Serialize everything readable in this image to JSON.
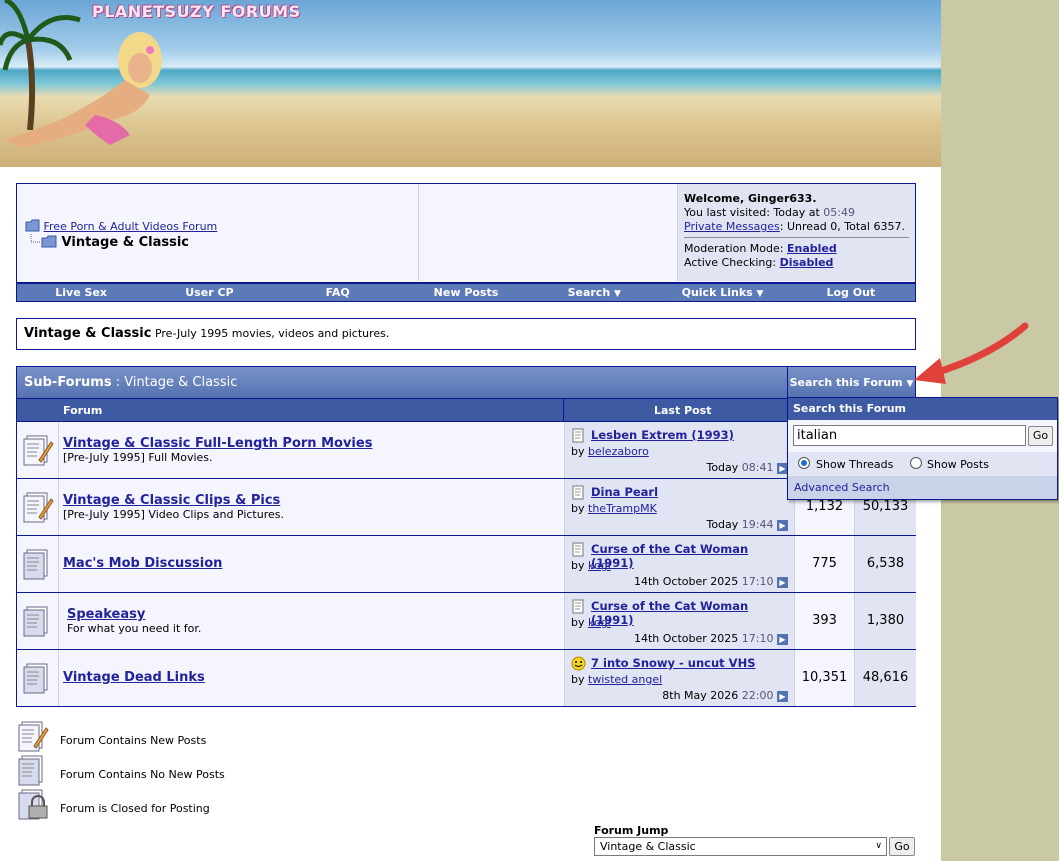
{
  "banner": {
    "logo_text": "PLANETSUZY FORUMS"
  },
  "breadcrumb": {
    "parent_link": "Free Porn & Adult Videos Forum",
    "current": "Vintage & Classic"
  },
  "user_panel": {
    "welcome": "Welcome, Ginger633.",
    "last_visited_label": "You last visited: Today at",
    "last_visited_time": "05:49",
    "pm_link": "Private Messages",
    "pm_text": ": Unread 0, Total 6357.",
    "moderation_label": "Moderation Mode:",
    "moderation_value": "Enabled",
    "checking_label": "Active Checking:",
    "checking_value": "Disabled"
  },
  "navbar": [
    "Live Sex",
    "User CP",
    "FAQ",
    "New Posts",
    "Search",
    "Quick Links",
    "Log Out"
  ],
  "forum_desc": {
    "name": "Vintage & Classic",
    "text": "Pre-July 1995 movies, videos and pictures."
  },
  "subforums": {
    "header_label": "Sub-Forums",
    "header_sep": " : ",
    "header_name": "Vintage & Classic",
    "search_button": "Search this Forum",
    "col_forum": "Forum",
    "col_last_post": "Last Post",
    "rows": [
      {
        "title": "Vintage & Classic Full-Length Porn Movies",
        "desc": "[Pre-July 1995] Full Movies.",
        "lp_title": "Lesben Extrem (1993)",
        "lp_by": "by",
        "lp_user": "belezaboro",
        "lp_date": "Today",
        "lp_time": "08:41",
        "threads": "",
        "posts": ""
      },
      {
        "title": "Vintage & Classic Clips & Pics",
        "desc": "[Pre-July 1995] Video Clips and Pictures.",
        "lp_title": "Dina Pearl",
        "lp_by": "by",
        "lp_user": "theTrampMK",
        "lp_date": "Today",
        "lp_time": "19:44",
        "threads": "1,132",
        "posts": "50,133"
      },
      {
        "title": "Mac's Mob Discussion",
        "desc": "",
        "lp_title": "Curse of the Cat Woman (1991)",
        "lp_by": "by",
        "lp_user": "kogi",
        "lp_date": "14th October 2025",
        "lp_time": "17:10",
        "threads": "775",
        "posts": "6,538"
      },
      {
        "title": "Speakeasy",
        "desc": "For what you need it for.",
        "lp_title": "Curse of the Cat Woman (1991)",
        "lp_by": "by",
        "lp_user": "kogi",
        "lp_date": "14th October 2025",
        "lp_time": "17:10",
        "threads": "393",
        "posts": "1,380"
      },
      {
        "title": "Vintage Dead Links",
        "desc": "",
        "lp_title": "7 into Snowy - uncut VHS",
        "lp_by": "by",
        "lp_user": "twisted angel",
        "lp_date": "8th May 2026",
        "lp_time": "22:00",
        "threads": "10,351",
        "posts": "48,616"
      }
    ]
  },
  "search_dropdown": {
    "title": "Search this Forum",
    "query": "italian",
    "go_label": "Go",
    "option_threads": "Show Threads",
    "option_posts": "Show Posts",
    "selected": "Show Threads",
    "advanced": "Advanced Search"
  },
  "legend": [
    "Forum Contains New Posts",
    "Forum Contains No New Posts",
    "Forum is Closed for Posting"
  ],
  "forum_jump": {
    "label": "Forum Jump",
    "selected": "Vintage & Classic",
    "go_label": "Go"
  },
  "colors": {
    "accent": "#3d5aa3",
    "arrow": "#e0423b",
    "link": "#22229c"
  }
}
